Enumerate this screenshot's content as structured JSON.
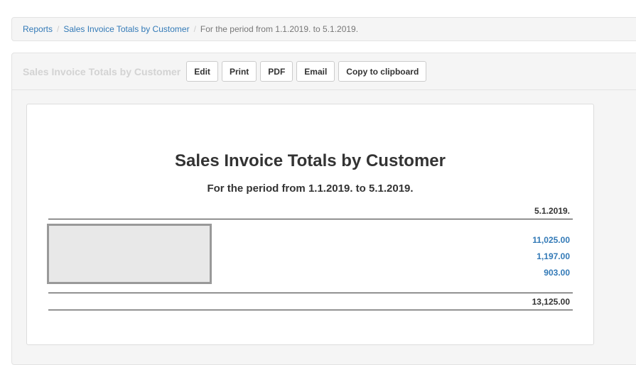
{
  "breadcrumb": {
    "items": [
      {
        "label": "Reports"
      },
      {
        "label": "Sales Invoice Totals by Customer"
      }
    ],
    "current": "For the period from 1.1.2019. to 5.1.2019."
  },
  "toolbar": {
    "title": "Sales Invoice Totals by Customer",
    "buttons": {
      "edit": "Edit",
      "print": "Print",
      "pdf": "PDF",
      "email": "Email",
      "copy": "Copy to clipboard"
    }
  },
  "report": {
    "title": "Sales Invoice Totals by Customer",
    "subtitle": "For the period from 1.1.2019. to 5.1.2019.",
    "column_header": "5.1.2019.",
    "rows": [
      {
        "value": "11,025.00"
      },
      {
        "value": "1,197.00"
      },
      {
        "value": "903.00"
      }
    ],
    "total": "13,125.00"
  },
  "colors": {
    "link": "#337ab7",
    "muted_title": "#d3d3d3",
    "panel_bg": "#f5f5f5"
  }
}
